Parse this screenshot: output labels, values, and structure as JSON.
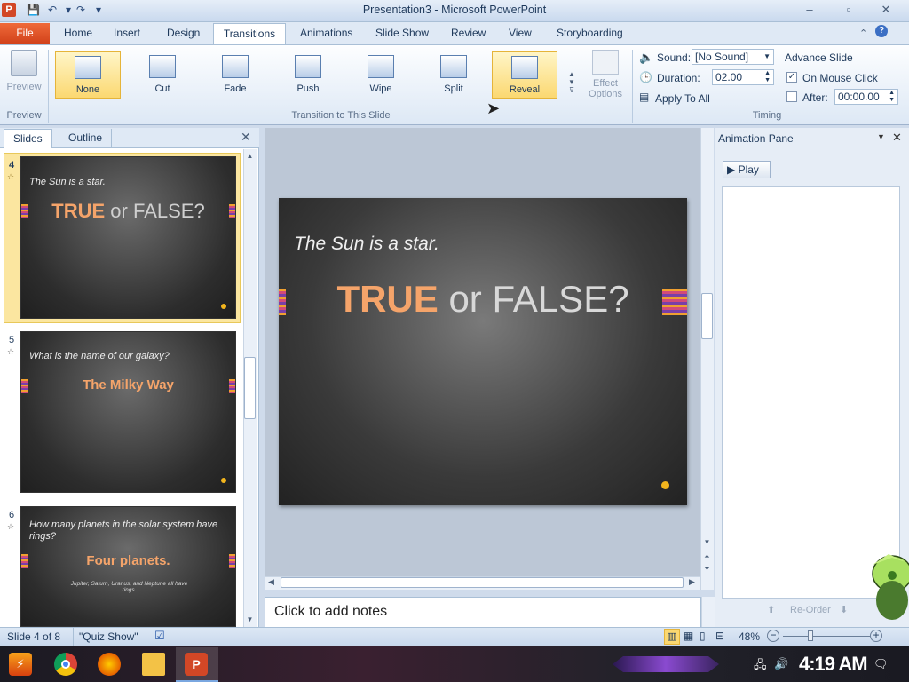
{
  "app": {
    "title": "Presentation3 - Microsoft PowerPoint"
  },
  "qat": {
    "save": "💾",
    "undo": "↶",
    "redo": "↷",
    "more": "▾"
  },
  "window_buttons": {
    "minimize": "–",
    "maximize": "▫",
    "close": "✕"
  },
  "tabs": [
    "File",
    "Home",
    "Insert",
    "Design",
    "Transitions",
    "Animations",
    "Slide Show",
    "Review",
    "View",
    "Storyboarding"
  ],
  "active_tab": "Transitions",
  "ribbon": {
    "preview": {
      "label": "Preview",
      "group": "Preview"
    },
    "transitions": [
      {
        "label": "None",
        "selected": true
      },
      {
        "label": "Cut",
        "selected": false
      },
      {
        "label": "Fade",
        "selected": false
      },
      {
        "label": "Push",
        "selected": false
      },
      {
        "label": "Wipe",
        "selected": false
      },
      {
        "label": "Split",
        "selected": false
      },
      {
        "label": "Reveal",
        "selected": false
      }
    ],
    "effect_options": {
      "line1": "Effect",
      "line2": "Options"
    },
    "transition_group": "Transition to This Slide",
    "timing": {
      "sound_label": "Sound:",
      "sound_value": "[No Sound]",
      "duration_label": "Duration:",
      "duration_value": "02.00",
      "apply_all": "Apply To All",
      "advance_title": "Advance Slide",
      "on_mouse_click": "On Mouse Click",
      "on_mouse_click_checked": true,
      "after_label": "After:",
      "after_value": "00:00.00",
      "after_checked": false,
      "group": "Timing"
    }
  },
  "left_panel": {
    "tabs": [
      "Slides",
      "Outline"
    ],
    "close": "✕",
    "slides": [
      {
        "num": "4",
        "question": "The Sun is a star.",
        "answer_a": "TRUE",
        "answer_b": " or FALSE?",
        "selected": true
      },
      {
        "num": "5",
        "question": "What is the name of our galaxy?",
        "answer": "The Milky Way",
        "selected": false
      },
      {
        "num": "6",
        "question": "How many planets in the solar system have rings?",
        "answer": "Four planets.",
        "detail": "Jupiter, Saturn, Uranus, and Neptune all have rings.",
        "selected": false
      }
    ]
  },
  "main_slide": {
    "question": "The Sun is a star.",
    "answer_a": "TRUE",
    "answer_b": " or FALSE?"
  },
  "notes": {
    "placeholder": "Click to add notes"
  },
  "animation_pane": {
    "title": "Animation Pane",
    "play": "Play",
    "reorder": "Re-Order"
  },
  "status": {
    "slide": "Slide 4 of 8",
    "theme": "\"Quiz Show\"",
    "zoom": "48%",
    "zoom_fraction": 0.3
  },
  "taskbar": {
    "clock": "4:19 AM"
  },
  "colors": {
    "file_tab": "#d2421a",
    "accent_orange": "#f5a46a",
    "selected_transition": "#fbd871"
  }
}
